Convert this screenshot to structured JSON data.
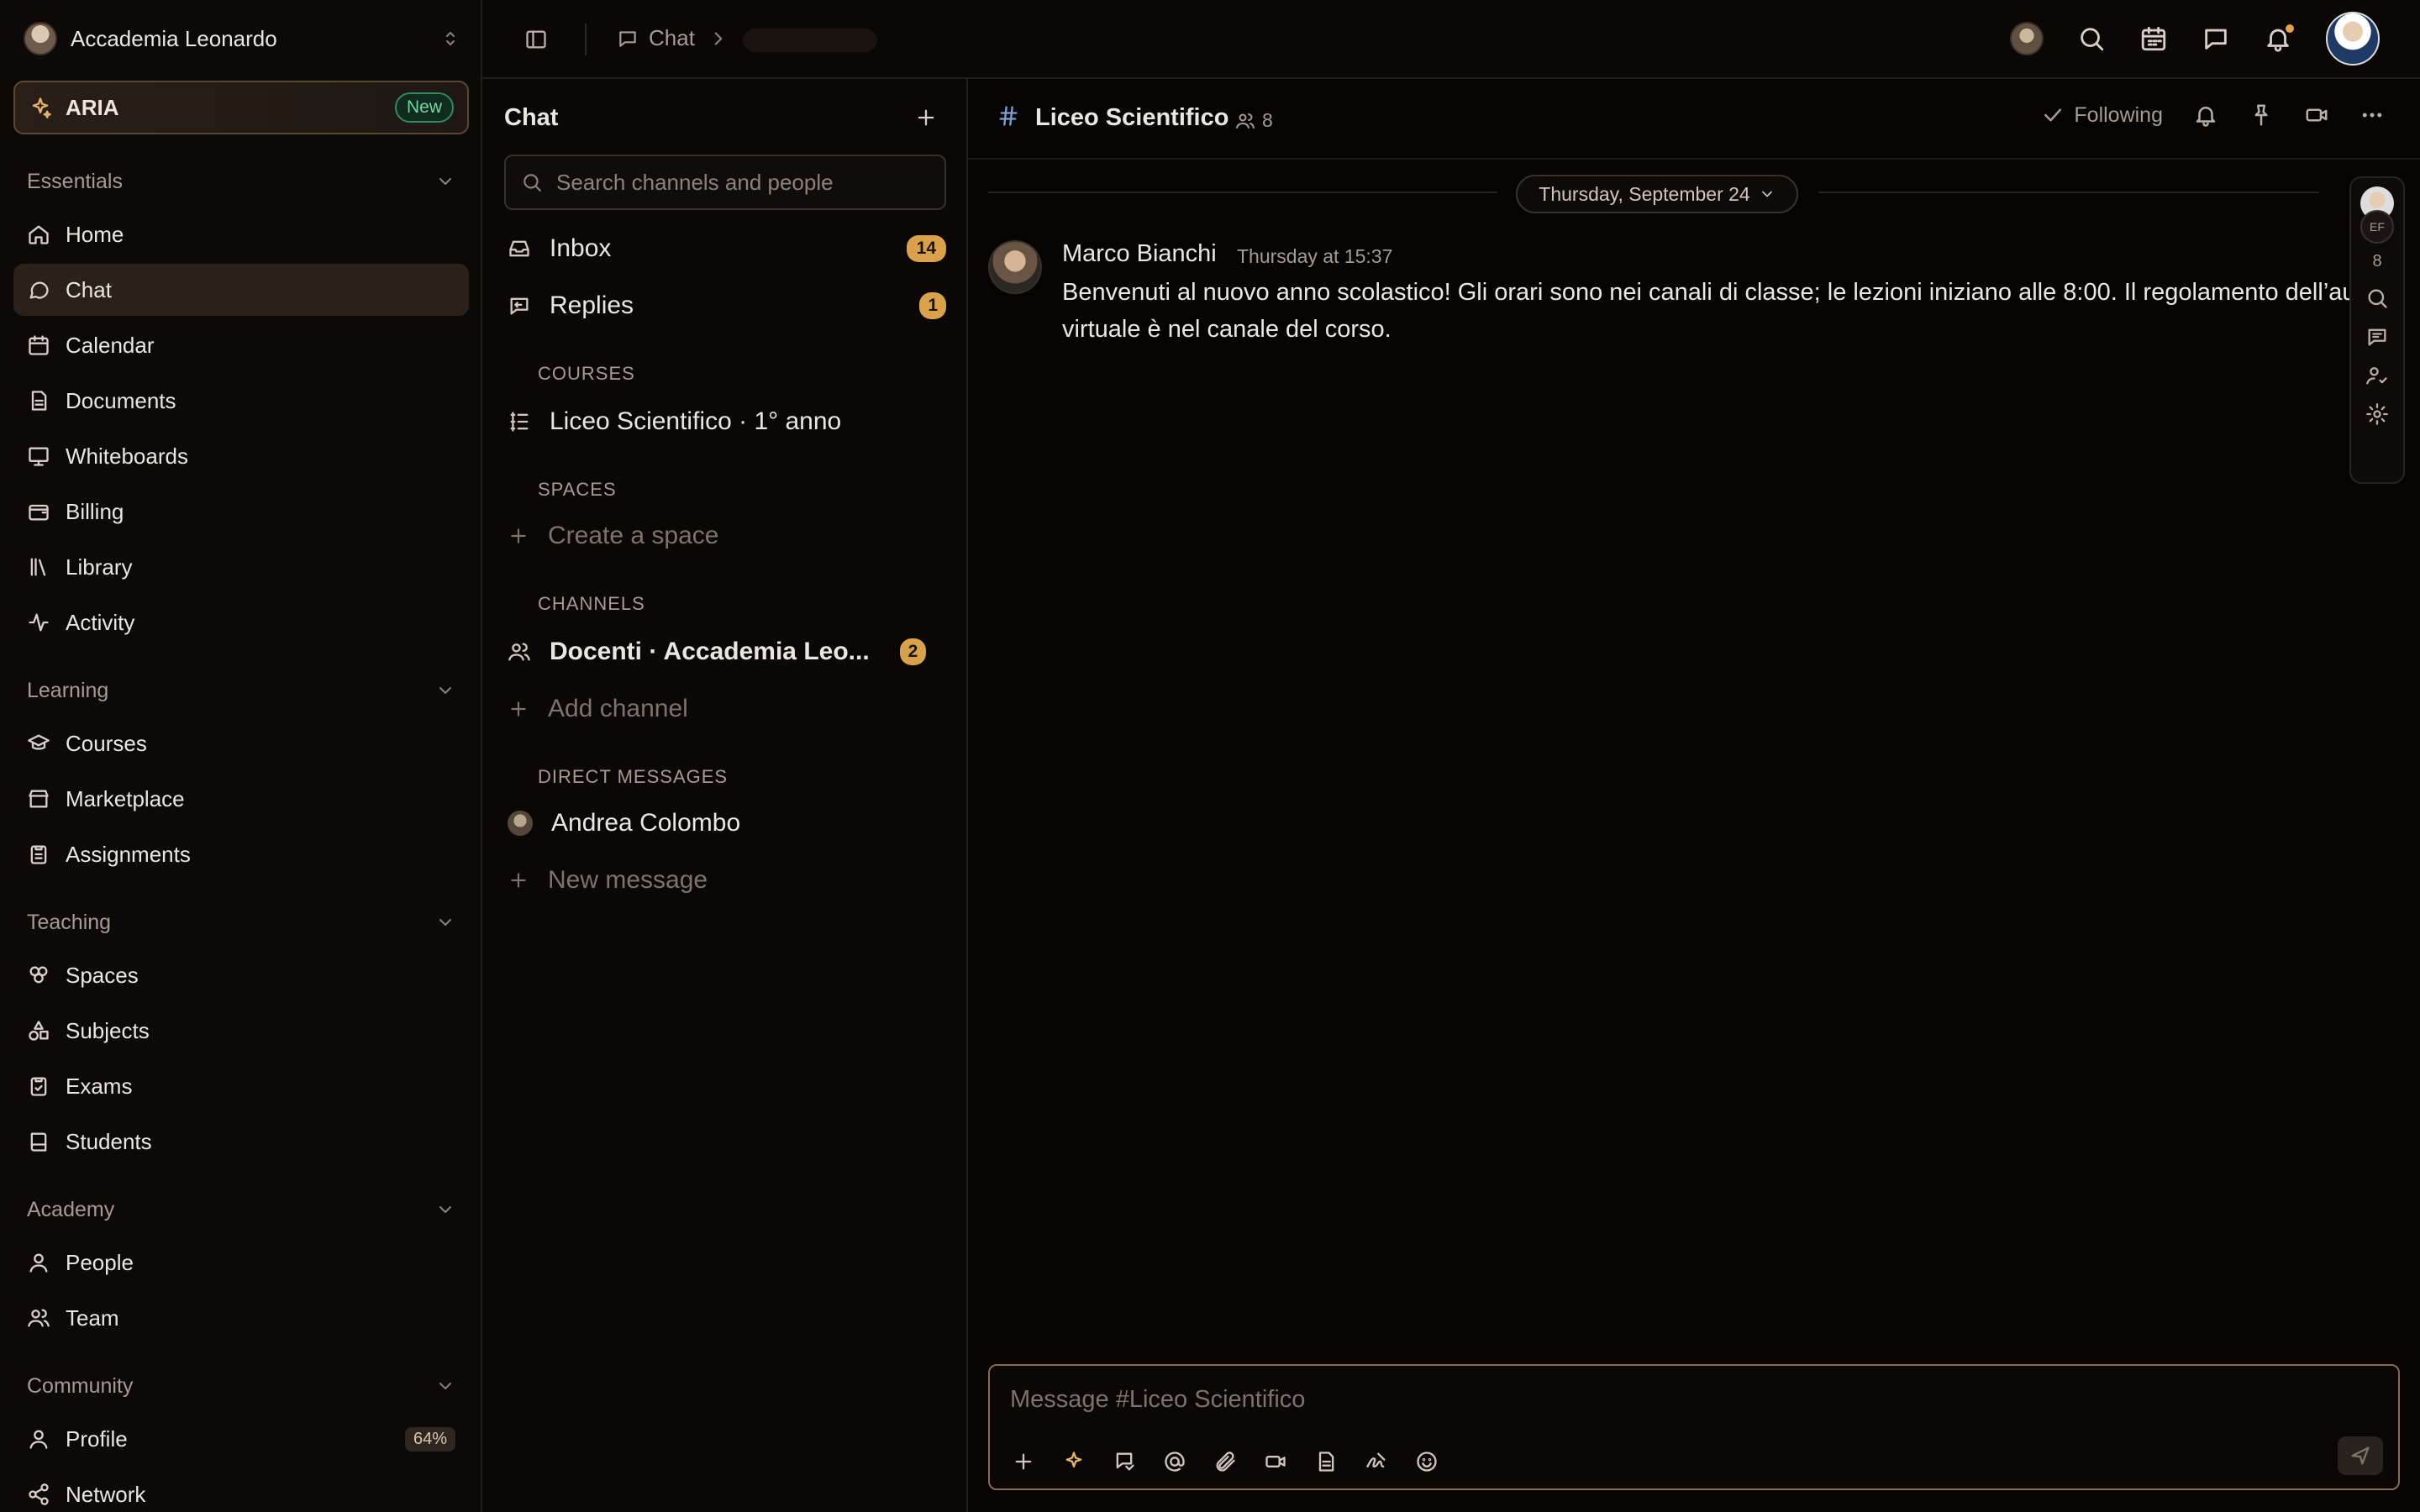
{
  "sidebar": {
    "org_name": "Accademia Leonardo",
    "aria": {
      "label": "ARIA",
      "badge": "New"
    },
    "sections": [
      {
        "title": "Essentials",
        "items": [
          {
            "label": "Home",
            "icon": "home-icon"
          },
          {
            "label": "Chat",
            "icon": "chat-icon",
            "active": true
          },
          {
            "label": "Calendar",
            "icon": "calendar-icon"
          },
          {
            "label": "Documents",
            "icon": "document-icon"
          },
          {
            "label": "Whiteboards",
            "icon": "whiteboard-icon"
          },
          {
            "label": "Billing",
            "icon": "billing-icon"
          },
          {
            "label": "Library",
            "icon": "library-icon"
          },
          {
            "label": "Activity",
            "icon": "activity-icon"
          }
        ]
      },
      {
        "title": "Learning",
        "items": [
          {
            "label": "Courses",
            "icon": "graduation-cap-icon"
          },
          {
            "label": "Marketplace",
            "icon": "store-icon"
          },
          {
            "label": "Assignments",
            "icon": "clipboard-icon"
          }
        ]
      },
      {
        "title": "Teaching",
        "items": [
          {
            "label": "Spaces",
            "icon": "spaces-icon"
          },
          {
            "label": "Subjects",
            "icon": "shapes-icon"
          },
          {
            "label": "Exams",
            "icon": "clipboard-check-icon"
          },
          {
            "label": "Students",
            "icon": "book-icon"
          }
        ]
      },
      {
        "title": "Academy",
        "items": [
          {
            "label": "People",
            "icon": "person-icon"
          },
          {
            "label": "Team",
            "icon": "team-icon"
          }
        ]
      },
      {
        "title": "Community",
        "items": [
          {
            "label": "Profile",
            "icon": "user-icon",
            "badge": "64%"
          },
          {
            "label": "Network",
            "icon": "share-icon"
          }
        ]
      }
    ]
  },
  "topbar": {
    "breadcrumb": "Chat"
  },
  "chatlist": {
    "title": "Chat",
    "search_placeholder": "Search channels and people",
    "inbox": {
      "label": "Inbox",
      "count": "14"
    },
    "replies": {
      "label": "Replies",
      "count": "1"
    },
    "courses_heading": "COURSES",
    "course": "Liceo Scientifico · 1° anno",
    "spaces_heading": "SPACES",
    "create_space": "Create a space",
    "channels_heading": "CHANNELS",
    "channel": {
      "label": "Docenti · Accademia Leo...",
      "count": "2"
    },
    "add_channel": "Add channel",
    "dm_heading": "DIRECT MESSAGES",
    "dm": "Andrea Colombo",
    "new_message": "New message"
  },
  "chat": {
    "channel_name": "Liceo Scientifico",
    "member_count": "8",
    "following": "Following",
    "date": "Thursday, September 24",
    "message": {
      "author": "Marco Bianchi",
      "time": "Thursday at 15:37",
      "text": "Benvenuti al nuovo anno scolastico! Gli orari sono nei canali di classe; le lezioni iniziano alle 8:00. Il regolamento dell’aula virtuale è nel canale del corso."
    },
    "rail": {
      "initials": "EF",
      "count": "8"
    },
    "composer_placeholder": "Message #Liceo Scientifico"
  },
  "colors": {
    "accent": "#d9a24a",
    "new_badge": "#6fd7a4",
    "hash": "#7ea2d8"
  }
}
